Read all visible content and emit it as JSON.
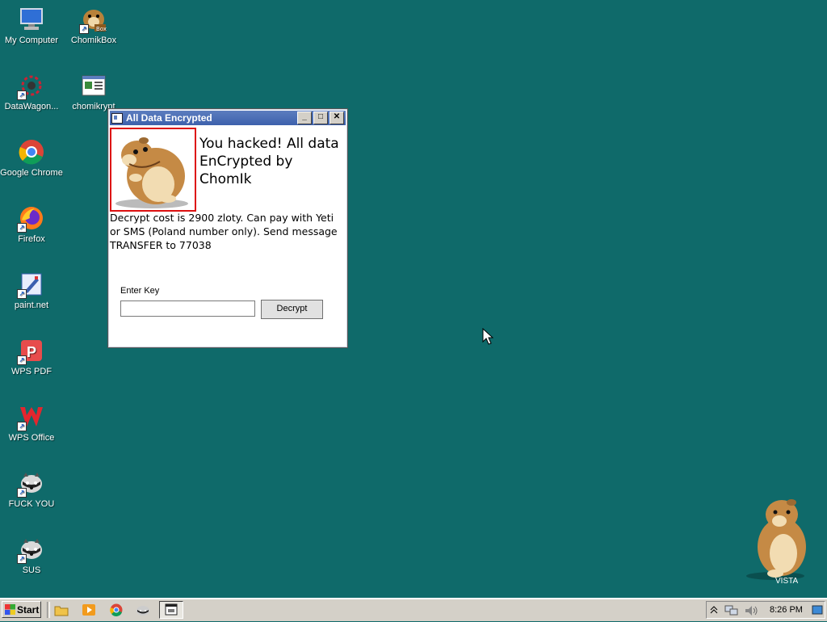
{
  "desktop": {
    "icons": [
      {
        "label": "My Computer",
        "icon": "my-computer-icon"
      },
      {
        "label": "ChomikBox",
        "icon": "chomikbox-icon"
      },
      {
        "label": "DataWagon...",
        "icon": "datawagon-icon"
      },
      {
        "label": "chomikrypt",
        "icon": "chomikrypt-icon"
      },
      {
        "label": "Google Chrome",
        "icon": "chrome-icon"
      },
      {
        "label": "Firefox",
        "icon": "firefox-icon"
      },
      {
        "label": "paint.net",
        "icon": "paintnet-icon"
      },
      {
        "label": "WPS PDF",
        "icon": "wps-pdf-icon"
      },
      {
        "label": "WPS Office",
        "icon": "wps-office-icon"
      },
      {
        "label": "FUCK YOU",
        "icon": "raccoon-icon"
      },
      {
        "label": "SUS",
        "icon": "raccoon-icon"
      }
    ]
  },
  "window": {
    "title": "All Data Encrypted",
    "headline": "You hacked! All data EnCrypted by ChomIk",
    "message": "Decrypt cost is 2900 zloty. Can pay with Yeti or SMS (Poland number only). Send message TRANSFER to 77038",
    "key_label": "Enter Key",
    "key_value": "",
    "decrypt_label": "Decrypt",
    "buttons": {
      "minimize": "_",
      "maximize": "□",
      "close": "✕"
    }
  },
  "widget": {
    "label": "VISTA"
  },
  "taskbar": {
    "start_label": "Start",
    "clock": "8:26 PM"
  },
  "colors": {
    "desktop_bg": "#0f6a6a",
    "titlebar": "#3d61ac",
    "image_border": "#dd1111"
  }
}
